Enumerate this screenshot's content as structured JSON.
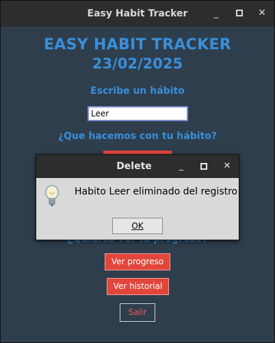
{
  "window": {
    "title": "Easy Habit Tracker",
    "min_icon": "minimize-icon",
    "max_icon": "maximize-icon",
    "close_icon": "close-icon"
  },
  "main": {
    "heading": "EASY HABIT TRACKER",
    "date": "23/02/2025",
    "habit_label": "Escribe un hábito",
    "habit_value": "Leer",
    "question": "¿Que hacemos con tu hábito?",
    "partial_text": "¿Quieres ver tu progreso?",
    "buttons": {
      "progress": "Ver progreso",
      "history": "Ver historial",
      "exit": "Salir"
    }
  },
  "dialog": {
    "title": "Delete",
    "message": "Habito Leer eliminado del registro",
    "ok": "OK",
    "icon": "lightbulb-icon"
  },
  "colors": {
    "accent": "#3a8fd9",
    "button_red": "#e2463b",
    "background": "#2f3e4d"
  }
}
